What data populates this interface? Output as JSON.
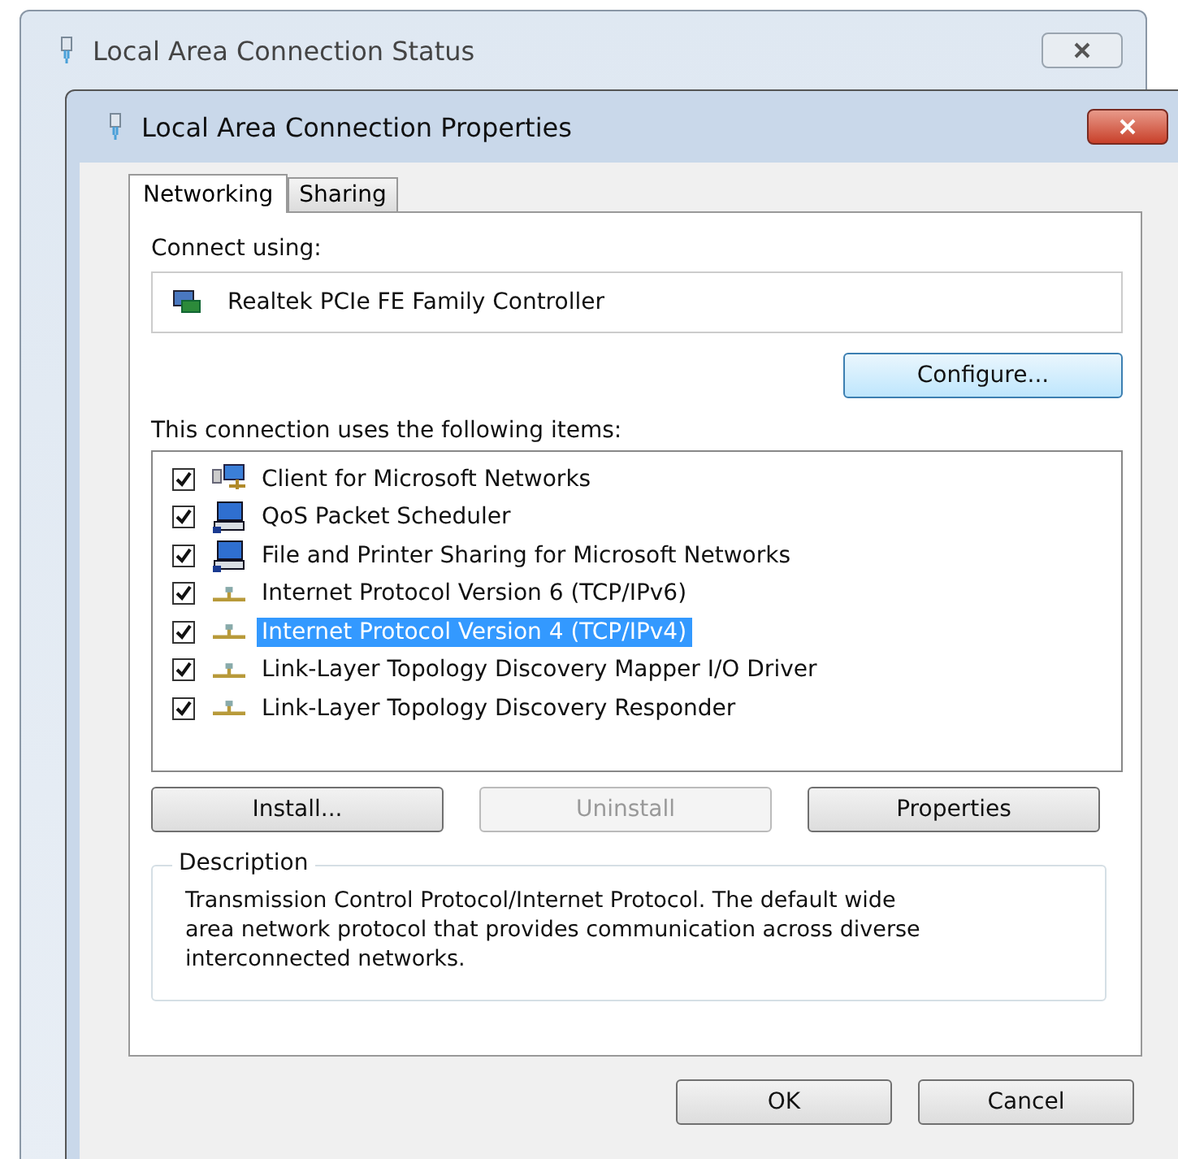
{
  "back_window": {
    "title": "Local Area Connection Status"
  },
  "window": {
    "title": "Local Area Connection Properties"
  },
  "tabs": [
    {
      "label": "Networking",
      "selected": true
    },
    {
      "label": "Sharing",
      "selected": false
    }
  ],
  "connect_using": {
    "label": "Connect using:",
    "adapter": "Realtek PCIe FE Family Controller"
  },
  "configure_button": {
    "label": "Configure...",
    "disabled": false
  },
  "items_label": "This connection uses the following items:",
  "items": [
    {
      "label": "Client for Microsoft Networks",
      "kind": "client",
      "checked": true,
      "selected": false
    },
    {
      "label": "QoS Packet Scheduler",
      "kind": "service",
      "checked": true,
      "selected": false
    },
    {
      "label": "File and Printer Sharing for Microsoft Networks",
      "kind": "service",
      "checked": true,
      "selected": false
    },
    {
      "label": "Internet Protocol Version 6 (TCP/IPv6)",
      "kind": "protocol",
      "checked": true,
      "selected": false
    },
    {
      "label": "Internet Protocol Version 4 (TCP/IPv4)",
      "kind": "protocol",
      "checked": true,
      "selected": true
    },
    {
      "label": "Link-Layer Topology Discovery Mapper I/O Driver",
      "kind": "protocol",
      "checked": true,
      "selected": false
    },
    {
      "label": "Link-Layer Topology Discovery Responder",
      "kind": "protocol",
      "checked": true,
      "selected": false
    }
  ],
  "item_buttons": [
    {
      "label": "Install...",
      "disabled": false
    },
    {
      "label": "Uninstall",
      "disabled": true
    },
    {
      "label": "Properties",
      "disabled": false
    }
  ],
  "description": {
    "title": "Description",
    "text": "Transmission Control Protocol/Internet Protocol. The default wide area network protocol that provides communication across diverse interconnected networks."
  },
  "dialog_buttons": [
    {
      "label": "OK",
      "disabled": false
    },
    {
      "label": "Cancel",
      "disabled": false
    }
  ]
}
